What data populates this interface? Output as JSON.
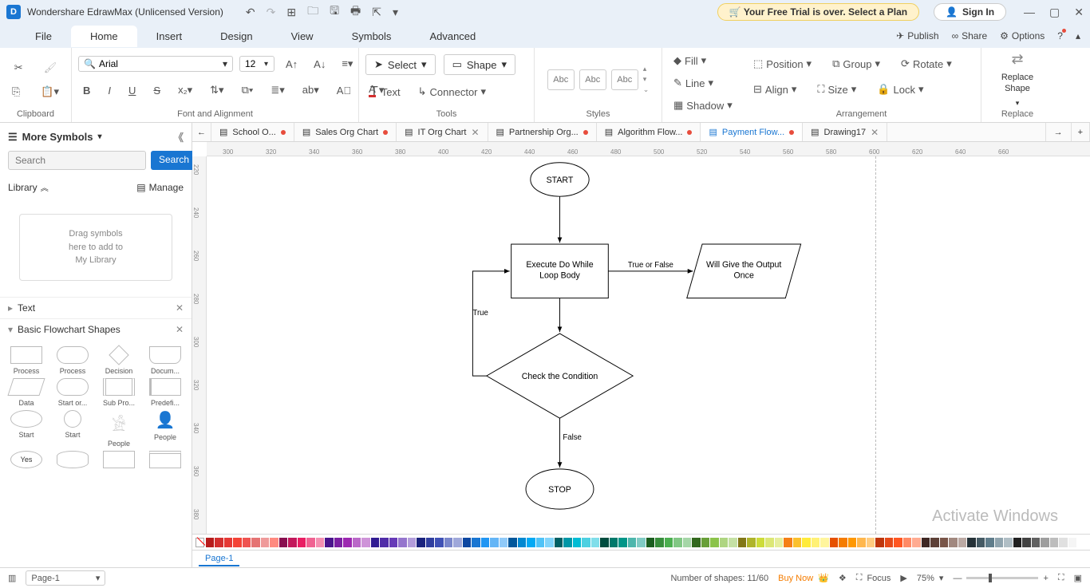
{
  "titlebar": {
    "app_name": "Wondershare EdrawMax (Unlicensed Version)",
    "trial_text": "Your Free Trial is over. Select a Plan",
    "signin": "Sign In"
  },
  "menu": {
    "tabs": [
      "File",
      "Home",
      "Insert",
      "Design",
      "View",
      "Symbols",
      "Advanced"
    ],
    "active": "Home",
    "right": {
      "publish": "Publish",
      "share": "Share",
      "options": "Options"
    }
  },
  "ribbon": {
    "clipboard": "Clipboard",
    "font_name": "Arial",
    "font_size": "12",
    "font_align_label": "Font and Alignment",
    "select": "Select",
    "shape": "Shape",
    "text": "Text",
    "connector": "Connector",
    "tools_label": "Tools",
    "style_abc": "Abc",
    "styles_label": "Styles",
    "fill": "Fill",
    "line": "Line",
    "shadow": "Shadow",
    "position": "Position",
    "align": "Align",
    "group": "Group",
    "size": "Size",
    "rotate": "Rotate",
    "lock": "Lock",
    "arrangement_label": "Arrangement",
    "replace_shape": "Replace\nShape",
    "replace_label": "Replace"
  },
  "doctabs": [
    {
      "label": "School O...",
      "modified": true,
      "closable": false
    },
    {
      "label": "Sales Org Chart",
      "modified": true,
      "closable": false
    },
    {
      "label": "IT Org Chart",
      "modified": false,
      "closable": true
    },
    {
      "label": "Partnership Org...",
      "modified": true,
      "closable": false
    },
    {
      "label": "Algorithm Flow...",
      "modified": true,
      "closable": false
    },
    {
      "label": "Payment Flow...",
      "modified": true,
      "closable": false,
      "active": true
    },
    {
      "label": "Drawing17",
      "modified": false,
      "closable": true
    }
  ],
  "sidebar": {
    "header": "More Symbols",
    "search_placeholder": "Search",
    "search_btn": "Search",
    "library": "Library",
    "manage": "Manage",
    "dropzone": "Drag symbols\nhere to add to\nMy Library",
    "text_section": "Text",
    "shapes_section": "Basic Flowchart Shapes",
    "shapes": [
      "Process",
      "Process",
      "Decision",
      "Docum...",
      "Data",
      "Start or...",
      "Sub Pro...",
      "Predefi...",
      "Start",
      "Start",
      "People",
      "People",
      "Yes",
      "",
      "",
      ""
    ]
  },
  "flowchart": {
    "start": "START",
    "exec": "Execute Do While\nLoop Body",
    "cond": "Check the Condition",
    "output": "Will Give the Output\nOnce",
    "stop": "STOP",
    "true_or_false": "True or False",
    "true": "True",
    "false": "False"
  },
  "ruler_h": [
    "300",
    "320",
    "340",
    "360",
    "380",
    "400",
    "420",
    "440",
    "460",
    "480",
    "500",
    "520",
    "540",
    "560",
    "580",
    "600",
    "620",
    "640",
    "660"
  ],
  "ruler_v": [
    "220",
    "240",
    "260",
    "280",
    "300",
    "320",
    "340",
    "360",
    "380"
  ],
  "palette_colors": [
    "#b71c1c",
    "#d32f2f",
    "#e53935",
    "#f44336",
    "#ef5350",
    "#e57373",
    "#ef9a9a",
    "#ff8a80",
    "#880e4f",
    "#c2185b",
    "#e91e63",
    "#f06292",
    "#f48fb1",
    "#4a148c",
    "#7b1fa2",
    "#9c27b0",
    "#ba68c8",
    "#ce93d8",
    "#311b92",
    "#512da8",
    "#673ab7",
    "#9575cd",
    "#b39ddb",
    "#1a237e",
    "#303f9f",
    "#3f51b5",
    "#7986cb",
    "#9fa8da",
    "#0d47a1",
    "#1976d2",
    "#2196f3",
    "#64b5f6",
    "#90caf9",
    "#01579b",
    "#0288d1",
    "#03a9f4",
    "#4fc3f7",
    "#81d4fa",
    "#006064",
    "#0097a7",
    "#00bcd4",
    "#4dd0e1",
    "#80deea",
    "#004d40",
    "#00796b",
    "#009688",
    "#4db6ac",
    "#80cbc4",
    "#1b5e20",
    "#388e3c",
    "#4caf50",
    "#81c784",
    "#a5d6a7",
    "#33691e",
    "#689f38",
    "#8bc34a",
    "#aed581",
    "#c5e1a5",
    "#827717",
    "#afb42b",
    "#cddc39",
    "#dce775",
    "#e6ee9c",
    "#f57f17",
    "#fbc02d",
    "#ffeb3b",
    "#fff176",
    "#fff59d",
    "#e65100",
    "#f57c00",
    "#ff9800",
    "#ffb74d",
    "#ffcc80",
    "#bf360c",
    "#e64a19",
    "#ff5722",
    "#ff8a65",
    "#ffab91",
    "#3e2723",
    "#5d4037",
    "#795548",
    "#a1887f",
    "#bcaaa4",
    "#263238",
    "#455a64",
    "#607d8b",
    "#90a4ae",
    "#b0bec5",
    "#212121",
    "#424242",
    "#616161",
    "#9e9e9e",
    "#bdbdbd",
    "#e0e0e0",
    "#f5f5f5",
    "#ffffff"
  ],
  "pagebar": {
    "page": "Page-1",
    "page_tab": "Page-1"
  },
  "status": {
    "shapes": "Number of shapes: 11/60",
    "buy": "Buy Now",
    "focus": "Focus",
    "zoom": "75%"
  },
  "watermark": "Activate Windows"
}
